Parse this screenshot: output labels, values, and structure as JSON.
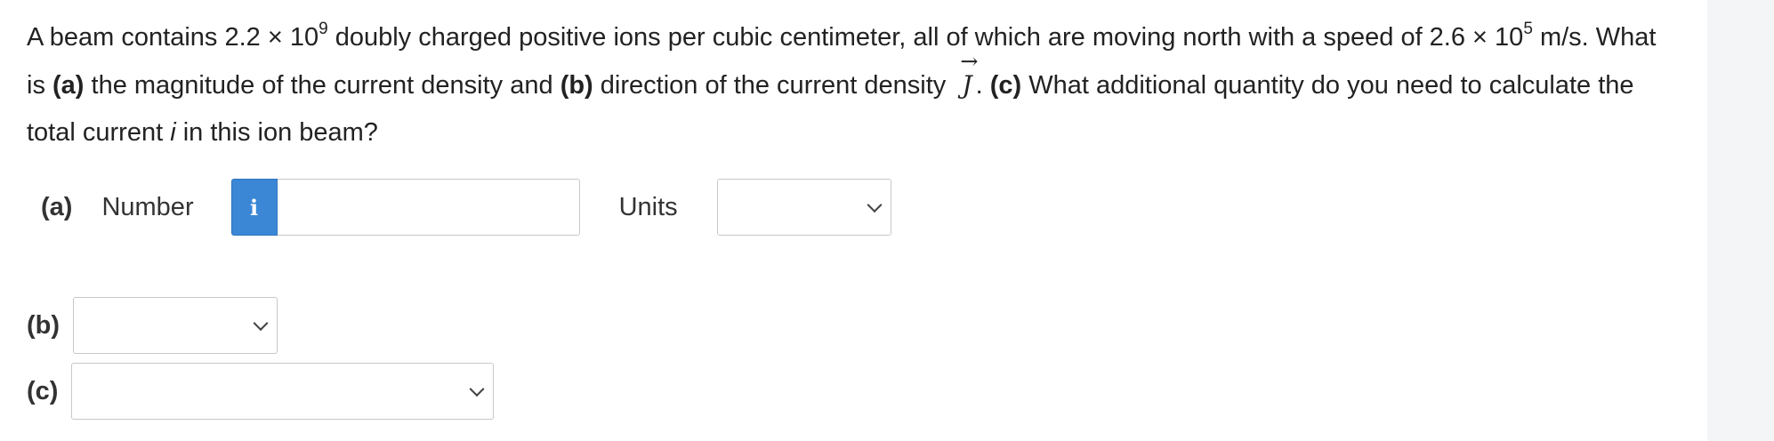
{
  "question": {
    "s1": "A beam contains 2.2 × 10",
    "exp1": "9",
    "s2": " doubly charged positive ions per cubic centimeter, all of which are moving north with a speed of 2.6 × 10",
    "exp2": "5",
    "s3": " m/s. What is ",
    "a_label": "(a)",
    "s4": " the magnitude of the current density and ",
    "b_label": "(b)",
    "s5": " direction of the current density ",
    "vec_symbol": "J",
    "vec_arrow": "→",
    "s6": ". ",
    "c_label": "(c)",
    "s7": " What additional quantity do you need to calculate the total current ",
    "i_symbol": "i",
    "s8": " in this ion beam?"
  },
  "part_a": {
    "label": "(a)",
    "number_label": "Number",
    "info_icon": "i",
    "value": "",
    "units_label": "Units",
    "units_selected": ""
  },
  "part_b": {
    "label": "(b)",
    "selected": ""
  },
  "part_c": {
    "label": "(c)",
    "selected": ""
  },
  "colors": {
    "accent": "#3b87d6",
    "border": "#c8c8c8",
    "text": "#222222",
    "gutter": "#f4f5f7"
  },
  "icons": {
    "info": "info-icon",
    "dropdown": "chevron-down-icon"
  }
}
